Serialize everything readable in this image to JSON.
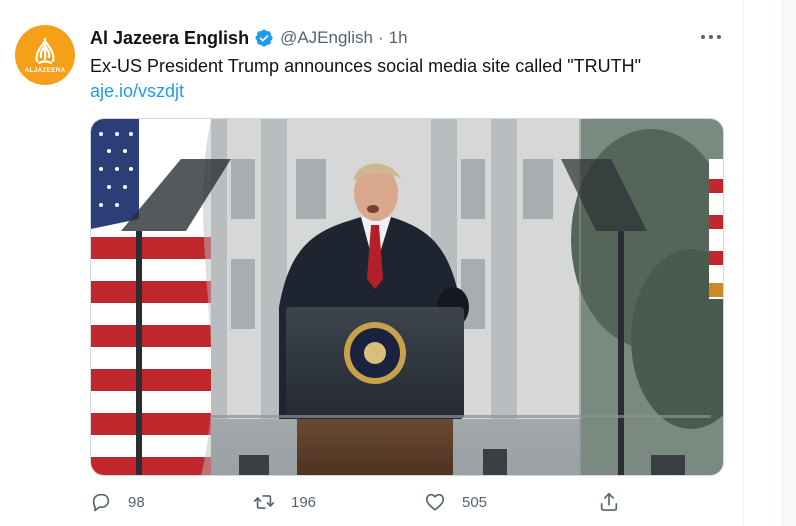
{
  "tweet": {
    "author": {
      "name": "Al Jazeera English",
      "handle": "@AJEnglish",
      "separator": "·",
      "time": "1h",
      "avatar_text": "ALJAZEERA",
      "avatar_color": "#f6a01a",
      "verified": true
    },
    "text": "Ex-US President Trump announces social media site called \"TRUTH\"",
    "link": "aje.io/vszdjt",
    "media": {
      "kind": "photo"
    },
    "actions": {
      "replies": "98",
      "retweets": "196",
      "likes": "505"
    }
  },
  "colors": {
    "text": "#0f1419",
    "secondary": "#536471",
    "link": "#1d9bf0",
    "verified": "#1d9bf0"
  },
  "icons": {
    "more": "more-horizontal-icon",
    "verified": "verified-badge-icon",
    "reply": "reply-icon",
    "retweet": "retweet-icon",
    "like": "like-icon",
    "share": "share-icon"
  }
}
